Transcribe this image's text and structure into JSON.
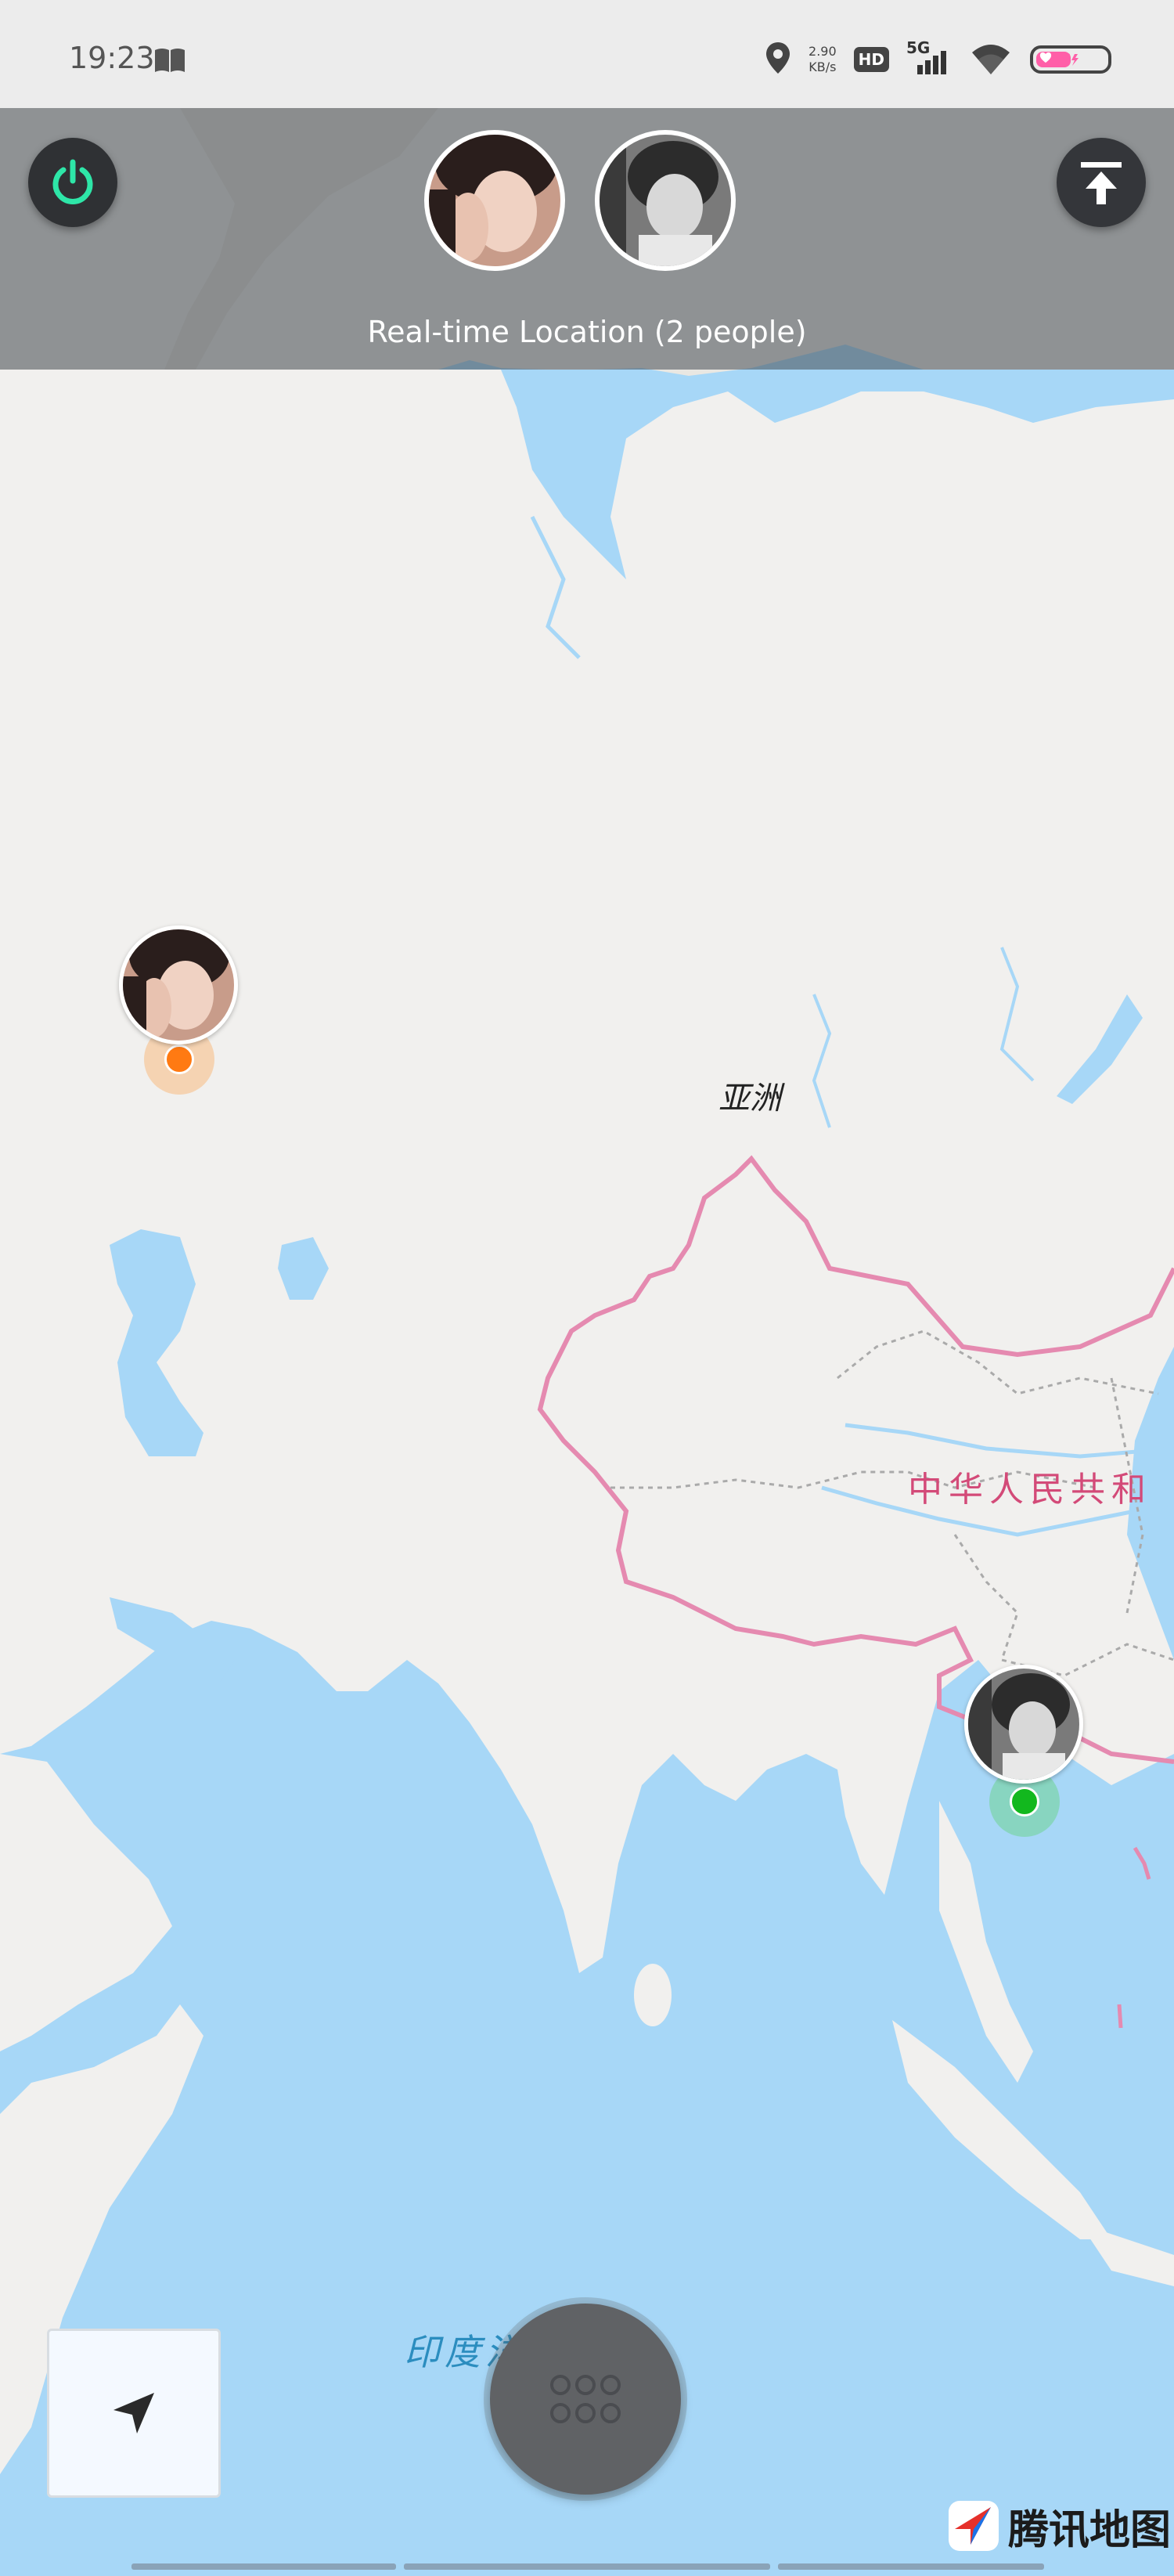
{
  "status_bar": {
    "time": "19:23",
    "net_speed_value": "2.90",
    "net_speed_unit": "KB/s",
    "hd_label": "HD",
    "network_label": "5G",
    "icons": [
      "book-icon",
      "location-icon",
      "signal-icon",
      "wifi-icon",
      "battery-icon"
    ]
  },
  "header": {
    "title": "Real-time Location (2 people)",
    "participants": [
      {
        "name": "participant-1",
        "avatar_style": "color portrait, woman with dark hair"
      },
      {
        "name": "participant-2",
        "avatar_style": "black-and-white portrait, child"
      }
    ],
    "power_button_icon": "power-icon",
    "upload_button_icon": "upload-icon",
    "accent_color": "#2ee6a8"
  },
  "map": {
    "labels": {
      "continent": "亚洲",
      "country": "中华人民共和",
      "ocean": "印度洋"
    },
    "marker_colors": {
      "participant_1": "#ff7a12",
      "participant_2": "#12b81e"
    },
    "colors": {
      "water": "#a7d7f7",
      "land": "#f1f0ee",
      "country_border": "#e58ab0"
    }
  },
  "controls": {
    "locate_icon": "navigation-arrow-icon",
    "menu_icon": "grid-dots-icon"
  },
  "brand": {
    "text": "腾讯地图",
    "icon": "tencent-map-logo-icon"
  }
}
